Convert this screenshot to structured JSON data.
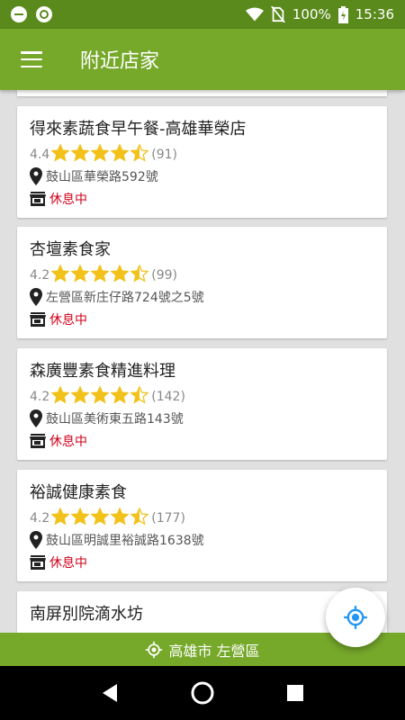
{
  "status_bar": {
    "battery": "100%",
    "time": "15:36"
  },
  "app_bar": {
    "title": "附近店家"
  },
  "shops": [
    {
      "name": "得來素蔬食早午餐-高雄華榮店",
      "rating": "4.4",
      "stars": 4.5,
      "reviews": "(91)",
      "address": "鼓山區華榮路592號",
      "status": "休息中"
    },
    {
      "name": "杏壇素食家",
      "rating": "4.2",
      "stars": 4.5,
      "reviews": "(99)",
      "address": "左營區新庄仔路724號之5號",
      "status": "休息中"
    },
    {
      "name": "森廣豐素食精進料理",
      "rating": "4.2",
      "stars": 4.5,
      "reviews": "(142)",
      "address": "鼓山區美術東五路143號",
      "status": "休息中"
    },
    {
      "name": "裕誠健康素食",
      "rating": "4.2",
      "stars": 4.5,
      "reviews": "(177)",
      "address": "鼓山區明誠里裕誠路1638號",
      "status": "休息中"
    },
    {
      "name": "南屏別院滴水坊"
    }
  ],
  "location_bar": {
    "label": "高雄市 左營區"
  },
  "colors": {
    "primary": "#76a82a",
    "status_bar": "#5a8a1c",
    "star": "#f2c21b",
    "closed": "#d0021b",
    "fab_icon": "#2196f3"
  }
}
